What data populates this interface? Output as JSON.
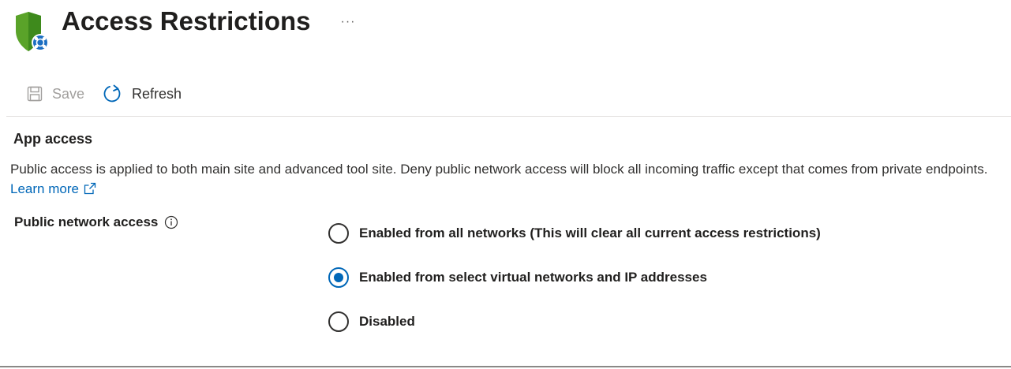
{
  "header": {
    "title": "Access Restrictions",
    "more_label": "···",
    "icon": "shield-network-icon"
  },
  "toolbar": {
    "save_label": "Save",
    "refresh_label": "Refresh",
    "save_enabled": false
  },
  "app_access": {
    "title": "App access",
    "description": "Public access is applied to both main site and advanced tool site. Deny public network access will block all incoming traffic except that comes from private endpoints.",
    "learn_more_label": "Learn more",
    "field_label": "Public network access",
    "options": [
      {
        "label": "Enabled from all networks (This will clear all current access restrictions)",
        "selected": false
      },
      {
        "label": "Enabled from select virtual networks and IP addresses",
        "selected": true
      },
      {
        "label": "Disabled",
        "selected": false
      }
    ]
  },
  "colors": {
    "accent": "#0067b8",
    "shield_green": "#5aa329",
    "text": "#323130",
    "disabled_text": "#a19f9d"
  }
}
